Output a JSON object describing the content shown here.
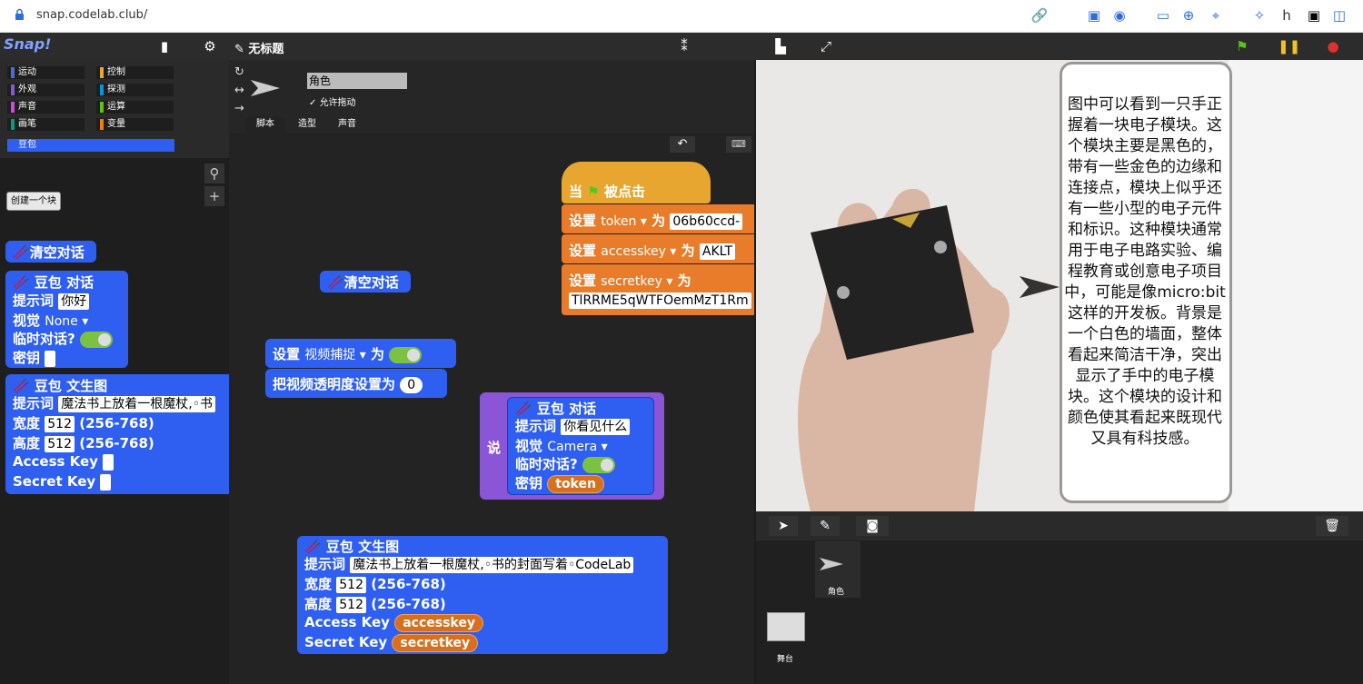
{
  "browser": {
    "url": "snap.codelab.club/"
  },
  "app": {
    "logo": "Snap!",
    "title": "✎ 无标题"
  },
  "categories": [
    {
      "label": "运动",
      "color": "#4a6cd4"
    },
    {
      "label": "控制",
      "color": "#e6a830"
    },
    {
      "label": "外观",
      "color": "#8a55d7"
    },
    {
      "label": "探测",
      "color": "#0494dc"
    },
    {
      "label": "声音",
      "color": "#cf4ad9"
    },
    {
      "label": "运算",
      "color": "#62c213"
    },
    {
      "label": "画笔",
      "color": "#00a178"
    },
    {
      "label": "变量",
      "color": "#ee7d16"
    }
  ],
  "palette": {
    "selected_category": "豆包",
    "make_block": "创建一个块",
    "clear_chat": "清空对话",
    "chat": {
      "title": "豆包 对话",
      "prompt_label": "提示词",
      "prompt_value": "你好",
      "vision_label": "视觉",
      "vision_value": "None",
      "temp_label": "临时对话?",
      "key_label": "密钥"
    },
    "t2i": {
      "title": "豆包 文生图",
      "prompt_label": "提示词",
      "prompt_value": "魔法书上放着一根魔杖,◦书",
      "width_label": "宽度",
      "width_value": "512",
      "range": "(256-768)",
      "height_label": "高度",
      "height_value": "512",
      "access_label": "Access Key",
      "secret_label": "Secret Key"
    }
  },
  "sprite": {
    "name": "角色",
    "draggable": "允许拖动",
    "tabs": [
      "脚本",
      "造型",
      "声音"
    ]
  },
  "scripts": {
    "hat": "当",
    "hat_clicked": "被点击",
    "set_label": "设置",
    "to_label": "为",
    "set1": {
      "var": "token",
      "value": "06b60ccd-"
    },
    "set2": {
      "var": "accesskey",
      "value": "AKLT"
    },
    "set3": {
      "var": "secretkey",
      "value": "TlRRME5qWTFOemMzT1Rm"
    },
    "clear_chat": "清空对话",
    "video": {
      "set": "设置",
      "var": "视频捕捉",
      "to": "为"
    },
    "transp": {
      "label": "把视频透明度设置为",
      "value": "0"
    },
    "say": "说",
    "chat": {
      "title": "豆包 对话",
      "prompt_label": "提示词",
      "prompt_value": "你看见什么",
      "vision_label": "视觉",
      "vision_value": "Camera",
      "temp_label": "临时对话?",
      "key_label": "密钥",
      "key_var": "token"
    },
    "t2i": {
      "title": "豆包 文生图",
      "prompt_label": "提示词",
      "prompt_value": "魔法书上放着一根魔杖,◦书的封面写着◦CodeLab",
      "width_label": "宽度",
      "width_value": "512",
      "range": "(256-768)",
      "height_label": "高度",
      "height_value": "512",
      "access_label": "Access Key",
      "access_var": "accesskey",
      "secret_label": "Secret Key",
      "secret_var": "secretkey"
    }
  },
  "stage": {
    "speech": "图中可以看到一只手正握着一块电子模块。这个模块主要是黑色的，带有一些金色的边缘和连接点，模块上似乎还有一些小型的电子元件和标识。这种模块通常用于电子电路实验、编程教育或创意电子项目中，可能是像micro:bit这样的开发板。背景是一个白色的墙面，整体看起来简洁干净，突出显示了手中的电子模块。这个模块的设计和颜色使其看起来既现代又具有科技感。"
  },
  "corral": {
    "sprite_label": "角色",
    "stage_label": "舞台"
  }
}
